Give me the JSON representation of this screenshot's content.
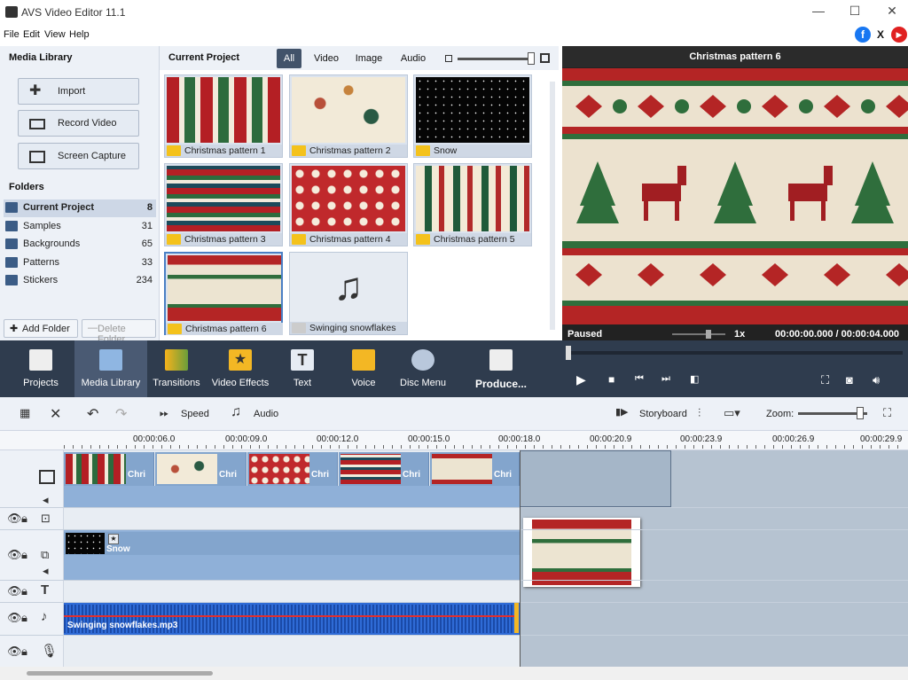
{
  "window": {
    "title": "AVS Video Editor 11.1",
    "minimize": "—",
    "maximize": "☐",
    "close": "✕"
  },
  "menu": [
    "File",
    "Edit",
    "View",
    "Help"
  ],
  "social": {
    "facebook": "f",
    "x": "X",
    "youtube": "▶"
  },
  "media_library": {
    "title": "Media Library",
    "buttons": [
      "Import",
      "Record Video",
      "Screen Capture"
    ],
    "folders_title": "Folders",
    "folders": [
      {
        "label": "Current Project",
        "count": "8"
      },
      {
        "label": "Samples",
        "count": "31"
      },
      {
        "label": "Backgrounds",
        "count": "65"
      },
      {
        "label": "Patterns",
        "count": "33"
      },
      {
        "label": "Stickers",
        "count": "234"
      }
    ],
    "add_folder": "Add Folder",
    "delete_folder": "Delete Folder"
  },
  "project": {
    "title": "Current Project",
    "tabs": [
      "All",
      "Video",
      "Image",
      "Audio"
    ],
    "items": [
      {
        "label": "Christmas pattern 1"
      },
      {
        "label": "Christmas pattern 2"
      },
      {
        "label": "Snow"
      },
      {
        "label": "Christmas pattern 3"
      },
      {
        "label": "Christmas pattern 4"
      },
      {
        "label": "Christmas pattern 5"
      },
      {
        "label": "Christmas pattern 6"
      },
      {
        "label": "Swinging snowflakes"
      }
    ]
  },
  "preview": {
    "title": "Christmas pattern 6",
    "status": "Paused",
    "speed": "1x",
    "time": "00:00:00.000 / 00:00:04.000"
  },
  "main_toolbar": [
    "Projects",
    "Media Library",
    "Transitions",
    "Video Effects",
    "Text",
    "Voice",
    "Disc Menu",
    "Produce..."
  ],
  "timeline_tools": {
    "speed": "Speed",
    "audio": "Audio",
    "storyboard": "Storyboard",
    "zoom": "Zoom:"
  },
  "ruler": [
    "00:00:06.0",
    "00:00:09.0",
    "00:00:12.0",
    "00:00:15.0",
    "00:00:18.0",
    "00:00:20.9",
    "00:00:23.9",
    "00:00:26.9",
    "00:00:29.9"
  ],
  "timeline": {
    "video_clips": [
      "Chri",
      "Chri",
      "Chri",
      "Chri",
      "Chri"
    ],
    "overlay_clip": "Snow",
    "audio_clip": "Swinging snowflakes.mp3"
  }
}
